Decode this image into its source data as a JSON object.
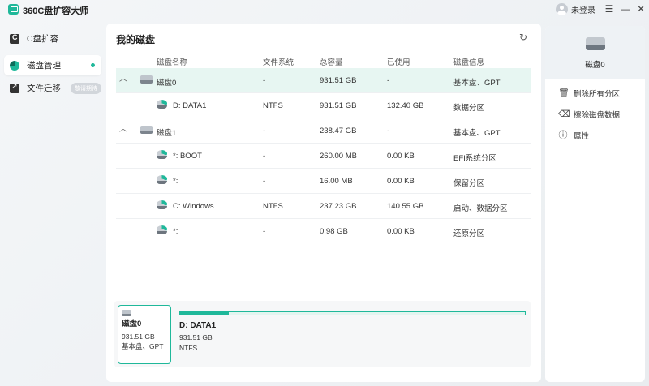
{
  "app": {
    "title": "360C盘扩容大师",
    "user_label": "未登录",
    "menu_icon": "hamburger-icon",
    "minimize_icon": "minimize-icon",
    "close_icon": "close-icon"
  },
  "sidebar": {
    "items": [
      {
        "label": "C盘扩容",
        "icon": "c-drive-icon",
        "active": false
      },
      {
        "label": "磁盘管理",
        "icon": "pie-chart-icon",
        "active": true
      },
      {
        "label": "文件迁移",
        "icon": "file-move-icon",
        "badge": "敬请期待",
        "active": false
      }
    ]
  },
  "main": {
    "title": "我的磁盘",
    "refresh_icon": "refresh-icon",
    "columns": [
      "磁盘名称",
      "文件系统",
      "总容量",
      "已使用",
      "磁盘信息"
    ],
    "rows": [
      {
        "type": "disk",
        "name": "磁盘0",
        "fs": "-",
        "total": "931.51 GB",
        "used": "-",
        "info": "基本盘、GPT",
        "selected": true
      },
      {
        "type": "part",
        "name": "D: DATA1",
        "fs": "NTFS",
        "total": "931.51 GB",
        "used": "132.40 GB",
        "info": "数据分区"
      },
      {
        "type": "disk",
        "name": "磁盘1",
        "fs": "-",
        "total": "238.47 GB",
        "used": "-",
        "info": "基本盘、GPT"
      },
      {
        "type": "part",
        "name": "*: BOOT",
        "fs": "-",
        "total": "260.00 MB",
        "used": "0.00 KB",
        "info": "EFI系统分区"
      },
      {
        "type": "part",
        "name": "*:",
        "fs": "-",
        "total": "16.00 MB",
        "used": "0.00 KB",
        "info": "保留分区"
      },
      {
        "type": "part",
        "name": "C: Windows",
        "fs": "NTFS",
        "total": "237.23 GB",
        "used": "140.55 GB",
        "info": "启动、数据分区"
      },
      {
        "type": "part",
        "name": "*:",
        "fs": "-",
        "total": "0.98 GB",
        "used": "0.00 KB",
        "info": "还原分区"
      }
    ]
  },
  "bottom": {
    "disk_card": {
      "name": "磁盘0",
      "size": "931.51 GB",
      "info": "基本盘、GPT"
    },
    "partition": {
      "name": "D: DATA1",
      "size": "931.51 GB",
      "fs": "NTFS",
      "used_fraction": 0.142
    }
  },
  "side": {
    "disk_name": "磁盘0",
    "actions": [
      {
        "label": "删除所有分区",
        "icon": "trash-icon"
      },
      {
        "label": "擦除磁盘数据",
        "icon": "eraser-icon"
      },
      {
        "label": "属性",
        "icon": "info-icon"
      }
    ]
  }
}
